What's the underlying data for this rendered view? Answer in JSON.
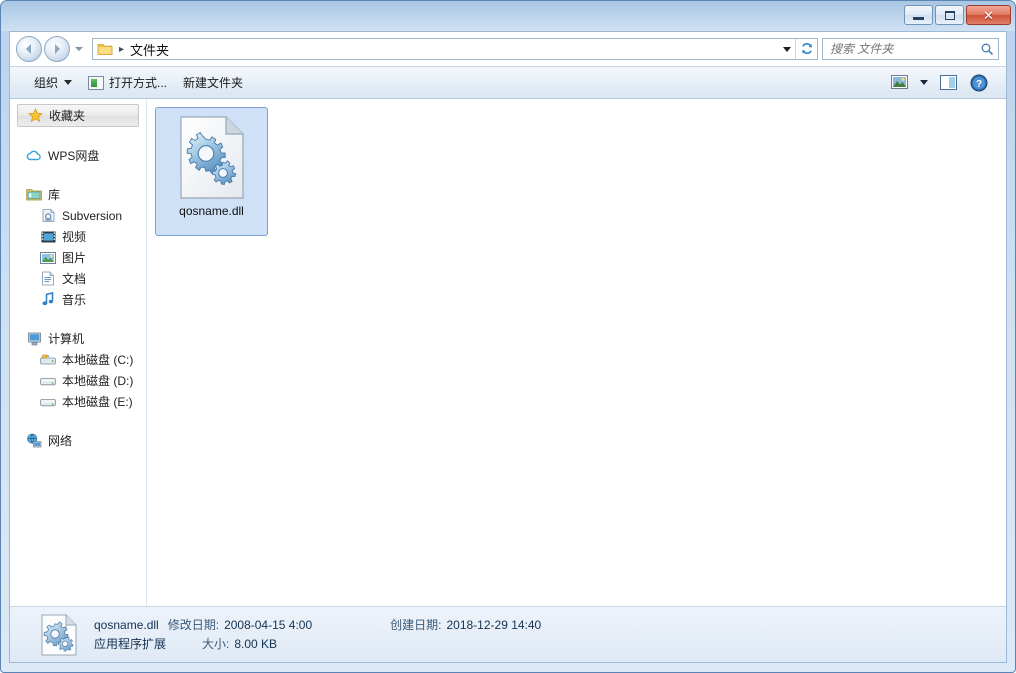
{
  "window": {
    "controls": {
      "minimize_label": "最小化",
      "maximize_label": "最大化",
      "close_label": "关闭"
    }
  },
  "navigation": {
    "back_label": "后退",
    "forward_label": "前进",
    "recent_label": "最近浏览的位置",
    "refresh_label": "刷新",
    "dropdown_label": "历史记录"
  },
  "address": {
    "folder_icon": "folder-icon",
    "separator": "▸",
    "path": "文件夹"
  },
  "search": {
    "placeholder": "搜索 文件夹",
    "value": "",
    "icon": "search-icon"
  },
  "toolbar": {
    "organize_label": "组织",
    "open_with_label": "打开方式...",
    "new_folder_label": "新建文件夹",
    "view_label": "更改您的视图",
    "preview_pane_label": "显示预览窗格",
    "help_label": "帮助"
  },
  "sidebar": {
    "groups": [
      {
        "items": [
          {
            "label": "收藏夹",
            "icon": "star-icon",
            "level": "header",
            "selected": true
          }
        ]
      },
      {
        "items": [
          {
            "label": "WPS网盘",
            "icon": "cloud-icon",
            "level": "root"
          }
        ]
      },
      {
        "items": [
          {
            "label": "库",
            "icon": "library-icon",
            "level": "root"
          },
          {
            "label": "Subversion",
            "icon": "subversion-icon",
            "level": "child"
          },
          {
            "label": "视频",
            "icon": "video-icon",
            "level": "child"
          },
          {
            "label": "图片",
            "icon": "pictures-icon",
            "level": "child"
          },
          {
            "label": "文档",
            "icon": "documents-icon",
            "level": "child"
          },
          {
            "label": "音乐",
            "icon": "music-icon",
            "level": "child"
          }
        ]
      },
      {
        "items": [
          {
            "label": "计算机",
            "icon": "computer-icon",
            "level": "root"
          },
          {
            "label": "本地磁盘 (C:)",
            "icon": "system-drive-icon",
            "level": "child"
          },
          {
            "label": "本地磁盘 (D:)",
            "icon": "drive-icon",
            "level": "child"
          },
          {
            "label": "本地磁盘 (E:)",
            "icon": "drive-icon",
            "level": "child"
          }
        ]
      },
      {
        "items": [
          {
            "label": "网络",
            "icon": "network-icon",
            "level": "root"
          }
        ]
      }
    ]
  },
  "content": {
    "files": [
      {
        "name": "qosname.dll",
        "icon": "dll-gear-icon",
        "selected": true
      }
    ]
  },
  "statusbar": {
    "file_name": "qosname.dll",
    "modified_key": "修改日期:",
    "modified_value": "2008-04-15 4:00",
    "created_key": "创建日期:",
    "created_value": "2018-12-29 14:40",
    "file_type": "应用程序扩展",
    "size_key": "大小:",
    "size_value": "8.00 KB",
    "icon": "dll-gear-icon"
  },
  "colors": {
    "frame_blue": "#b9d2ec",
    "selection_blue": "#cfe1f6",
    "selection_border": "#7da2cc",
    "close_red": "#cf5238",
    "status_text": "#18334f"
  }
}
